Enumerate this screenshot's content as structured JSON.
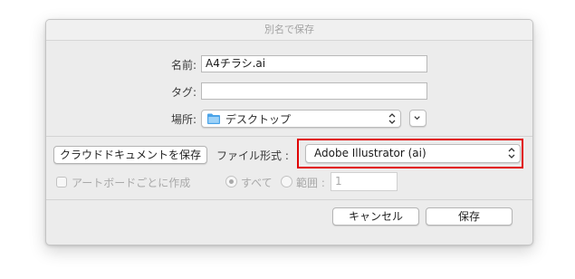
{
  "dialog": {
    "title": "別名で保存",
    "name_label": "名前:",
    "name_value": "A4チラシ.ai",
    "tags_label": "タグ:",
    "tags_value": "",
    "where_label": "場所:",
    "where_value": "デスクトップ",
    "cloud_button": "クラウドドキュメントを保存",
    "format_label": "ファイル形式 :",
    "format_value": "Adobe Illustrator (ai)",
    "artboard_checkbox": "アートボードごとに作成",
    "all_radio": "すべて",
    "range_radio": "範囲 :",
    "range_value": "1",
    "cancel_button": "キャンセル",
    "save_button": "保存"
  },
  "colors": {
    "highlight": "#e00000",
    "folder": "#4aa3e8"
  }
}
